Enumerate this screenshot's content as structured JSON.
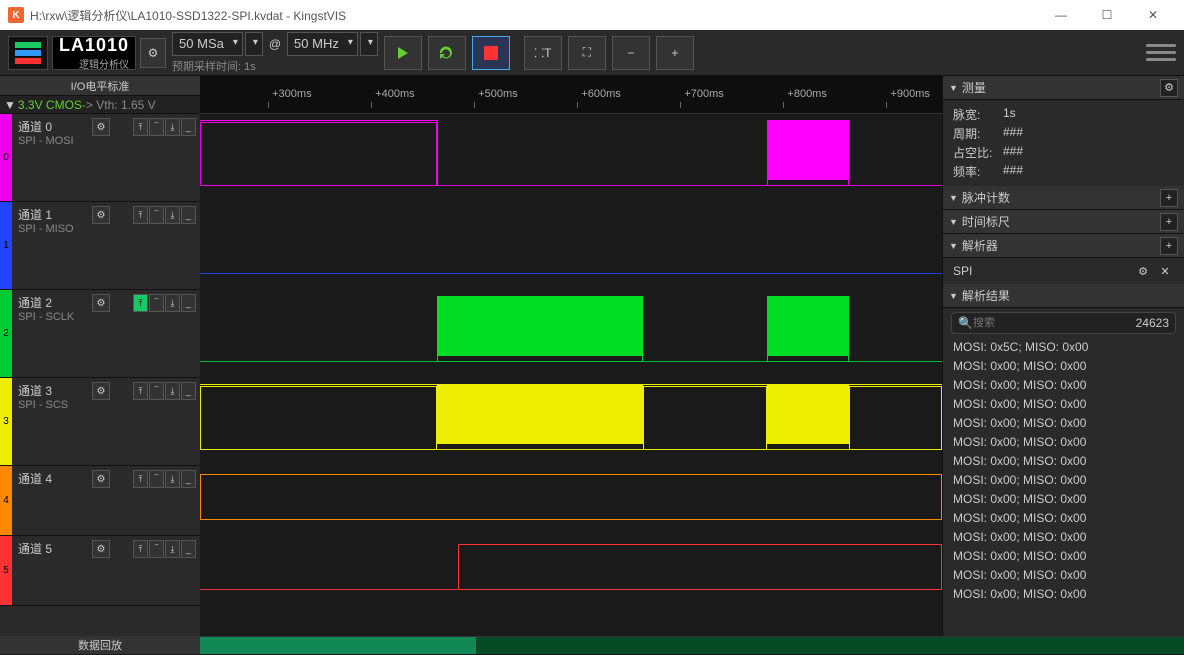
{
  "titlebar": {
    "icon": "K",
    "title": "H:\\rxw\\逻辑分析仪\\LA1010-SSD1322-SPI.kvdat - KingstVIS"
  },
  "device": {
    "name": "LA1010",
    "sub": "逻辑分析仪"
  },
  "sample": {
    "size": "50 MSa",
    "at": "@",
    "rate": "50 MHz",
    "expected": "预期采样时间: 1s"
  },
  "left": {
    "hdr": "I/O电平标准",
    "cmos_pre": "▼ ",
    "cmos": "3.3V CMOS",
    "vth": " -> Vth: 1.65 V"
  },
  "channels": [
    {
      "name": "通道 0",
      "sub": "SPI - MOSI",
      "color": "#e0e",
      "idx": "0"
    },
    {
      "name": "通道 1",
      "sub": "SPI - MISO",
      "color": "#24f",
      "idx": "1"
    },
    {
      "name": "通道 2",
      "sub": "SPI - SCLK",
      "color": "#0c3",
      "idx": "2",
      "edgeOn": true
    },
    {
      "name": "通道 3",
      "sub": "SPI - SCS",
      "color": "#ee0",
      "idx": "3"
    },
    {
      "name": "通道 4",
      "sub": "",
      "color": "#f80",
      "idx": "4"
    },
    {
      "name": "通道 5",
      "sub": "",
      "color": "#f33",
      "idx": "5"
    }
  ],
  "ruler": [
    "+300ms",
    "+400ms",
    "+500ms",
    "+600ms",
    "+700ms",
    "+800ms",
    "+900ms"
  ],
  "panels": {
    "measure": {
      "title": "测量",
      "rows": [
        [
          "脉宽:",
          "1s"
        ],
        [
          "周期:",
          "###"
        ],
        [
          "占空比:",
          "###"
        ],
        [
          "频率:",
          "###"
        ]
      ]
    },
    "pulse": {
      "title": "脉冲计数"
    },
    "time": {
      "title": "时间标尺"
    },
    "decoder": {
      "title": "解析器",
      "item": "SPI"
    },
    "results": {
      "title": "解析结果",
      "search": "搜索",
      "count": "24623"
    }
  },
  "decode": [
    "MOSI: 0x5C;  MISO: 0x00",
    "MOSI: 0x00;  MISO: 0x00",
    "MOSI: 0x00;  MISO: 0x00",
    "MOSI: 0x00;  MISO: 0x00",
    "MOSI: 0x00;  MISO: 0x00",
    "MOSI: 0x00;  MISO: 0x00",
    "MOSI: 0x00;  MISO: 0x00",
    "MOSI: 0x00;  MISO: 0x00",
    "MOSI: 0x00;  MISO: 0x00",
    "MOSI: 0x00;  MISO: 0x00",
    "MOSI: 0x00;  MISO: 0x00",
    "MOSI: 0x00;  MISO: 0x00",
    "MOSI: 0x00;  MISO: 0x00",
    "MOSI: 0x00;  MISO: 0x00"
  ],
  "footer": {
    "label": "数据回放"
  },
  "chart_data": {
    "type": "digital-timing",
    "time_unit": "ms",
    "visible_range": [
      230,
      950
    ],
    "channels": [
      {
        "name": "通道 0 / MOSI",
        "color": "#e0e",
        "high_segments": [
          [
            230,
            460
          ],
          [
            780,
            860
          ]
        ]
      },
      {
        "name": "通道 1 / MISO",
        "color": "#24f",
        "high_segments": []
      },
      {
        "name": "通道 2 / SCLK",
        "color": "#0c3",
        "high_segments": [
          [
            460,
            660
          ],
          [
            780,
            860
          ]
        ]
      },
      {
        "name": "通道 3 / SCS",
        "color": "#ee0",
        "high_segments": [
          [
            230,
            460
          ],
          [
            660,
            780
          ],
          [
            860,
            950
          ]
        ],
        "low_fill": [
          [
            460,
            660
          ],
          [
            780,
            860
          ]
        ]
      },
      {
        "name": "通道 4",
        "color": "#f80",
        "high_segments": [
          [
            230,
            950
          ]
        ]
      },
      {
        "name": "通道 5",
        "color": "#f33",
        "high_segments": [
          [
            480,
            950
          ]
        ]
      }
    ]
  }
}
